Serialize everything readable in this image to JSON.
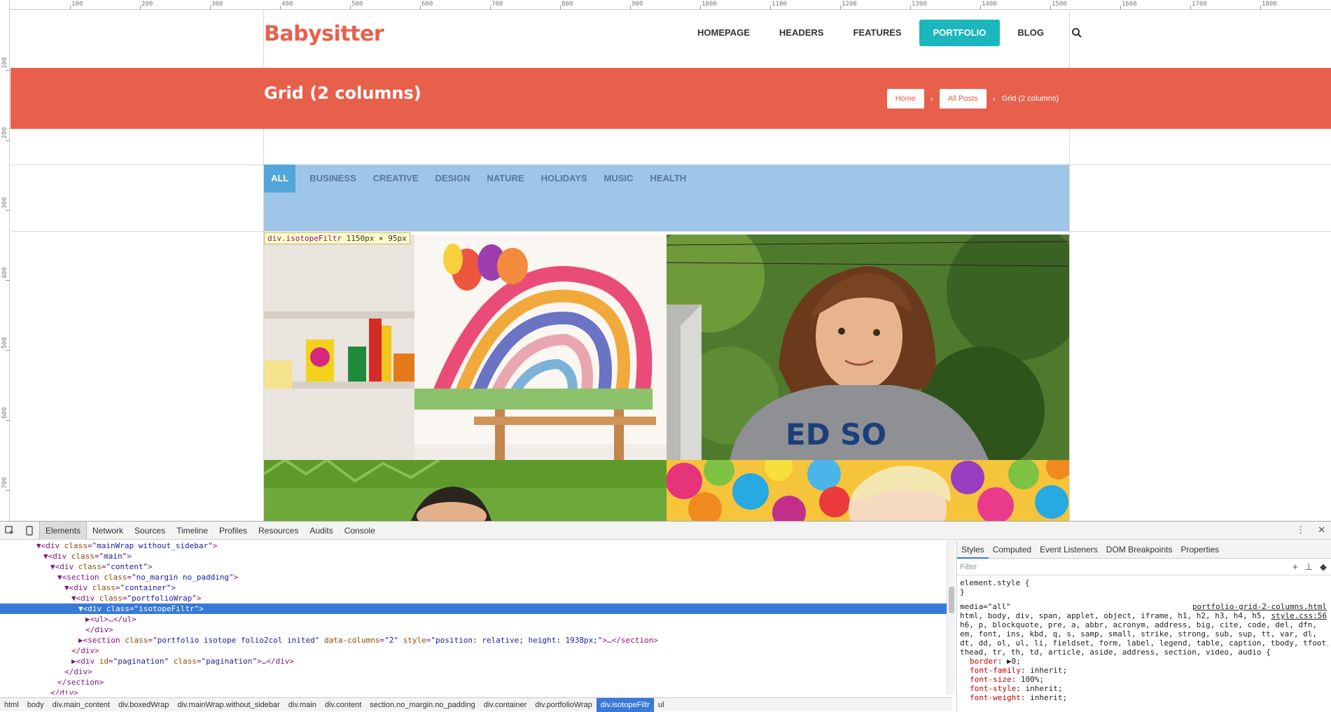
{
  "rulers": {
    "top_labels": [
      "100",
      "200",
      "300",
      "400",
      "500",
      "600",
      "700",
      "800",
      "900",
      "1000",
      "1100",
      "1200",
      "1300",
      "1400",
      "1500",
      "1600",
      "1700",
      "1800"
    ],
    "left_labels": [
      "100",
      "200",
      "300",
      "400",
      "500",
      "600",
      "700"
    ]
  },
  "site": {
    "logo": "Babysitter",
    "nav": [
      {
        "label": "HOMEPAGE"
      },
      {
        "label": "HEADERS"
      },
      {
        "label": "FEATURES"
      },
      {
        "label": "PORTFOLIO"
      },
      {
        "label": "BLOG"
      }
    ],
    "active_nav": "PORTFOLIO",
    "search_icon": "search-icon"
  },
  "titlebar": {
    "title": "Grid (2 columns)",
    "breadcrumbs": {
      "home": "Home",
      "all_posts": "All Posts",
      "sep": "›",
      "current": "Grid (2 columns)"
    }
  },
  "filters": {
    "items": [
      "ALL",
      "BUSINESS",
      "CREATIVE",
      "DESIGN",
      "NATURE",
      "HOLIDAYS",
      "MUSIC",
      "HEALTH"
    ],
    "active": "ALL"
  },
  "inspect_tooltip": {
    "selector": "div.isotopeFiltr",
    "size": "1150px × 95px"
  },
  "devtools": {
    "tabs": [
      "Elements",
      "Network",
      "Sources",
      "Timeline",
      "Profiles",
      "Resources",
      "Audits",
      "Console"
    ],
    "active_tab": "Elements",
    "dom_lines": [
      "▼<div class=\"mainWrap without_sidebar\">",
      "▼<div class=\"main\">",
      "▼<div class=\"content\">",
      "▼<section class=\"no_margin no_padding\">",
      "▼<div class=\"container\">",
      "▼<div class=\"portfolioWrap\">",
      "▼<div class=\"isotopeFiltr\">",
      "▶<ul>…</ul>",
      "</div>",
      "▶<section class=\"portfolio isotope folio2col inited\" data-columns=\"2\" style=\"position: relative; height: 1938px;\">…</section>",
      "</div>",
      "▶<div id=\"pagination\" class=\"pagination\">…</div>",
      "</div>",
      "</section>",
      "</div>"
    ],
    "breadcrumb": [
      "html",
      "body",
      "div.main_content",
      "div.boxedWrap",
      "div.mainWrap.without_sidebar",
      "div.main",
      "div.content",
      "section.no_margin.no_padding",
      "div.container",
      "div.portfolioWrap",
      "div.isotopeFiltr",
      "ul"
    ],
    "breadcrumb_active": "div.isotopeFiltr",
    "styles_tabs": [
      "Styles",
      "Computed",
      "Event Listeners",
      "DOM Breakpoints",
      "Properties"
    ],
    "styles_active": "Styles",
    "filter_placeholder": "Filter",
    "styles_lines": [
      "element.style {",
      "}",
      "media=\"all\"",
      "html, body, div, span, applet, object, iframe, h1, h2, h3, h4, h5,",
      "h6, p, blockquote, pre, a, abbr, acronym, address, big, cite, code, del, dfn,",
      "em, font, ins, kbd, q, s, samp, small, strike, strong, sub, sup, tt, var, dl,",
      "dt, dd, ol, ul, li, fieldset, form, label, legend, table, caption, tbody, tfoot,",
      "thead, tr, th, td, article, aside, address, section, video, audio {"
    ],
    "styles_links": [
      "portfolio-grid-2-columns.html",
      "style.css:56"
    ],
    "style_props": [
      {
        "name": "border",
        "value": "▶0;"
      },
      {
        "name": "font-family",
        "value": "inherit;"
      },
      {
        "name": "font-size",
        "value": "100%;"
      },
      {
        "name": "font-style",
        "value": "inherit;"
      },
      {
        "name": "font-weight",
        "value": "inherit;"
      }
    ]
  }
}
